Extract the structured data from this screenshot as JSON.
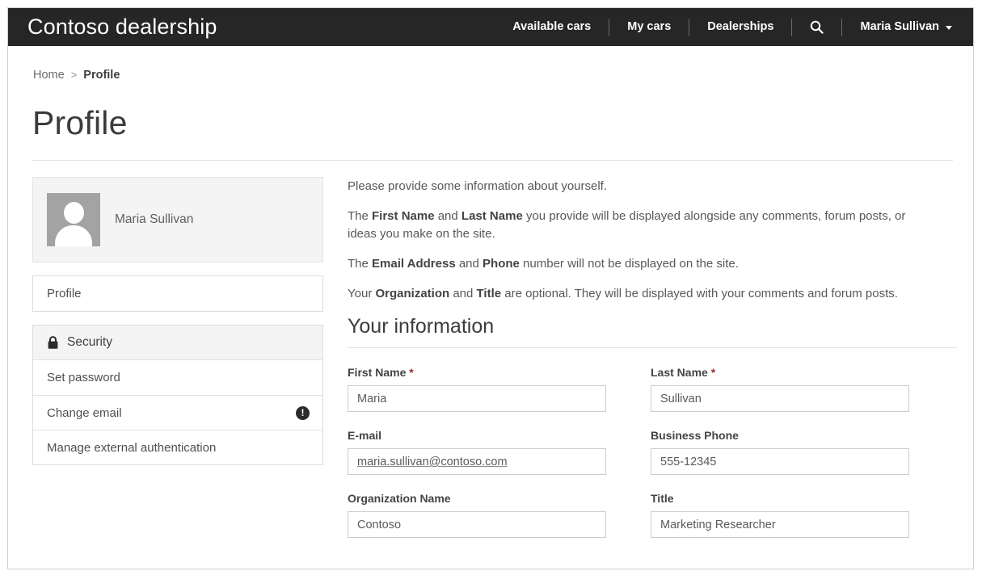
{
  "header": {
    "brand": "Contoso dealership",
    "nav": [
      {
        "label": "Available cars"
      },
      {
        "label": "My cars"
      },
      {
        "label": "Dealerships"
      }
    ],
    "search_icon": "search-icon",
    "user": {
      "name": "Maria Sullivan",
      "caret": "chevron-down-icon"
    }
  },
  "breadcrumb": {
    "home": "Home",
    "separator": ">",
    "current": "Profile"
  },
  "page": {
    "title": "Profile"
  },
  "sidebar": {
    "profile_card": {
      "name": "Maria Sullivan",
      "avatar_icon": "user-avatar-placeholder"
    },
    "primary": [
      {
        "label": "Profile"
      }
    ],
    "security": {
      "icon": "lock-icon",
      "title": "Security",
      "items": [
        {
          "label": "Set password",
          "badge": ""
        },
        {
          "label": "Change email",
          "badge": "!"
        },
        {
          "label": "Manage external authentication",
          "badge": ""
        }
      ]
    }
  },
  "main": {
    "intro": {
      "p1": "Please provide some information about yourself.",
      "p2_a": "The ",
      "p2_b1": "First Name",
      "p2_c": " and ",
      "p2_b2": "Last Name",
      "p2_d": " you provide will be displayed alongside any comments, forum posts, or ideas you make on the site.",
      "p3_a": "The ",
      "p3_b1": "Email Address",
      "p3_c": " and ",
      "p3_b2": "Phone",
      "p3_d": " number will not be displayed on the site.",
      "p4_a": "Your ",
      "p4_b1": "Organization",
      "p4_c": " and ",
      "p4_b2": "Title",
      "p4_d": " are optional. They will be displayed with your comments and forum posts."
    },
    "section_title": "Your information",
    "fields": {
      "first_name": {
        "label": "First Name",
        "required": "*",
        "value": "Maria"
      },
      "last_name": {
        "label": "Last Name",
        "required": "*",
        "value": "Sullivan"
      },
      "email": {
        "label": "E-mail",
        "value": "maria.sullivan@contoso.com"
      },
      "business_phone": {
        "label": "Business Phone",
        "value": "555-12345"
      },
      "organization": {
        "label": "Organization Name",
        "value": "Contoso"
      },
      "title": {
        "label": "Title",
        "value": "Marketing Researcher"
      }
    }
  },
  "colors": {
    "header_bg": "#262626",
    "panel_bg": "#f4f4f4",
    "border": "#dcdcdc",
    "required_asterisk": "#9c3030",
    "text": "#585858"
  }
}
